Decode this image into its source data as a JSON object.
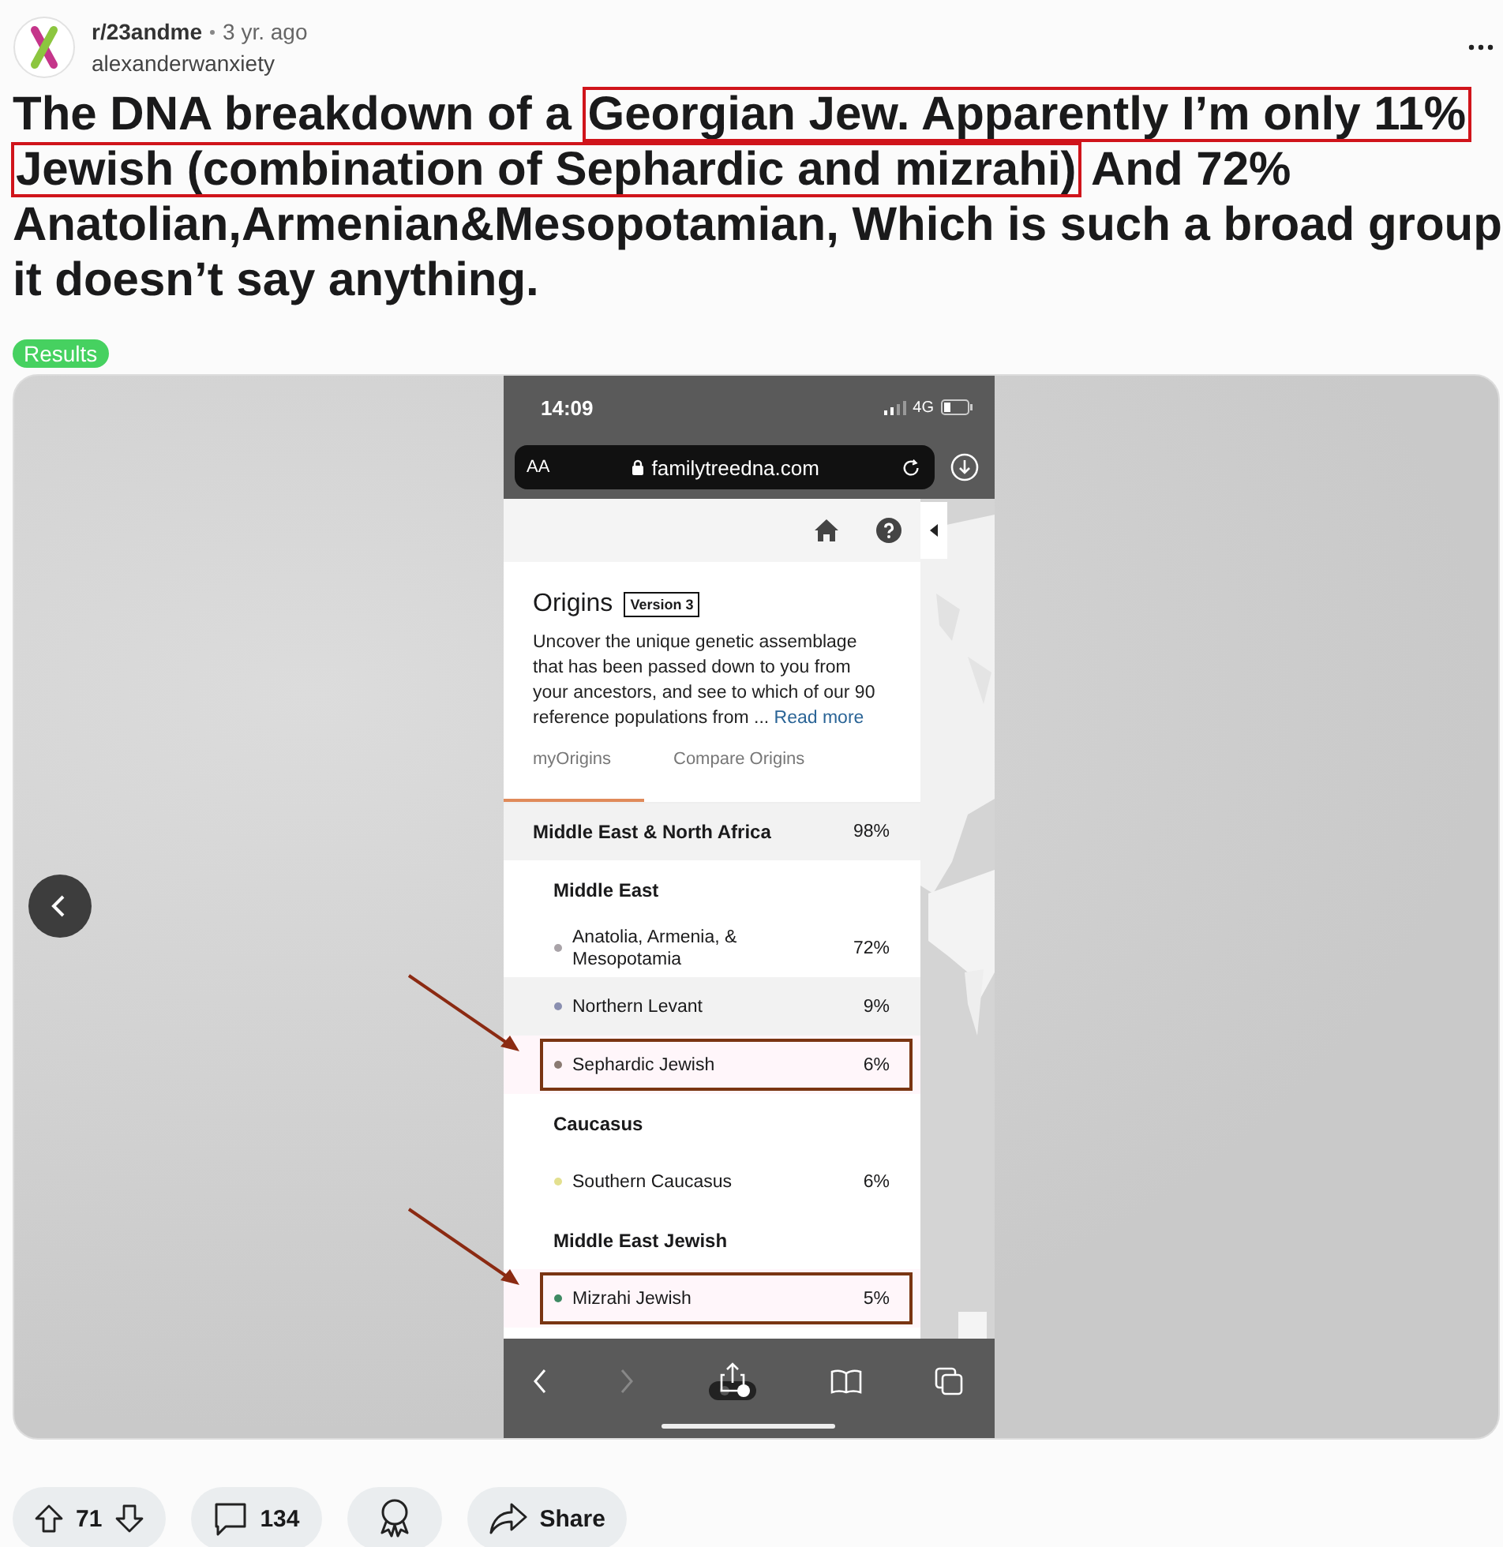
{
  "post": {
    "subreddit": "r/23andme",
    "age": "3 yr. ago",
    "author": "alexanderwanxiety",
    "title": [
      {
        "text": "The DNA breakdown of a ",
        "highlighted": false
      },
      {
        "text": "Georgian Jew. Apparently I’m only 11% ",
        "highlighted": true
      },
      {
        "text": "Jewish (combination of Sephardic and mizrahi)",
        "highlighted": true
      },
      {
        "text": " And 72% Anatolian,Armenian&Mesopotamian, Which is such a broad group it doesn’t say anything.",
        "highlighted": false
      }
    ],
    "flair": "Results"
  },
  "phone": {
    "time": "14:09",
    "network": "4G",
    "url": "familytreedna.com",
    "text_size_button": "AA",
    "heading": "Origins",
    "version": "Version 3",
    "description": "Uncover the unique genetic assemblage that has been passed down to you from your ancestors, and see to which of our 90 reference populations from ... ",
    "read_more": "Read more",
    "tabs": [
      {
        "label": "myOrigins",
        "selected": true
      },
      {
        "label": "Compare Origins",
        "selected": false
      }
    ],
    "rows": [
      {
        "kind": "region",
        "name": "Middle East & North Africa",
        "percent": "98%"
      },
      {
        "kind": "group",
        "name": "Middle East"
      },
      {
        "kind": "population",
        "name": "Anatolia, Armenia, & Mesopotamia",
        "percent": "72%",
        "color": "#a9a3a8",
        "shaded": false,
        "highlighted": false
      },
      {
        "kind": "population",
        "name": "Northern Levant",
        "percent": "9%",
        "color": "#8a8fb0",
        "shaded": true,
        "highlighted": false
      },
      {
        "kind": "population",
        "name": "Sephardic Jewish",
        "percent": "6%",
        "color": "#8a7a72",
        "shaded": false,
        "highlighted": true
      },
      {
        "kind": "group",
        "name": "Caucasus"
      },
      {
        "kind": "population",
        "name": "Southern Caucasus",
        "percent": "6%",
        "color": "#e3e08f",
        "shaded": false,
        "highlighted": false
      },
      {
        "kind": "group",
        "name": "Middle East Jewish"
      },
      {
        "kind": "population",
        "name": "Mizrahi Jewish",
        "percent": "5%",
        "color": "#3f8a63",
        "shaded": false,
        "highlighted": true
      }
    ]
  },
  "actions": {
    "votes": "71",
    "comments": "134",
    "share": "Share"
  }
}
